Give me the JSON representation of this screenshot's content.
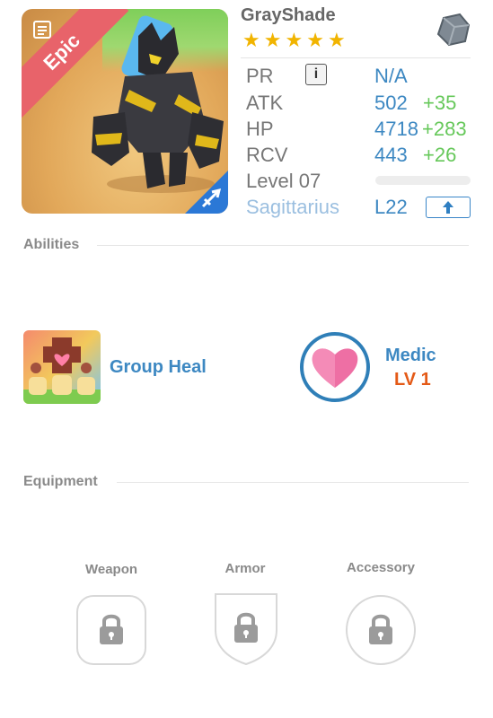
{
  "hero": {
    "name": "GrayShade",
    "rarity": "Epic",
    "stars": 5,
    "star_glyph": "★",
    "accent_star_color": "#f1b400"
  },
  "stats": {
    "pr_label": "PR",
    "pr_info": "i",
    "pr_value": "N/A",
    "atk_label": "ATK",
    "atk_value": "502",
    "atk_bonus": "+35",
    "hp_label": "HP",
    "hp_value": "4718",
    "hp_bonus": "+283",
    "rcv_label": "RCV",
    "rcv_value": "443",
    "rcv_bonus": "+26",
    "level_label": "Level 07",
    "level_progress": 0,
    "sign_label": "Sagittarius",
    "sign_level": "L22"
  },
  "abilities": {
    "section_title": "Abilities",
    "skill_name": "Group Heal",
    "trait_name": "Medic",
    "trait_level": "LV 1"
  },
  "equipment": {
    "section_title": "Equipment",
    "slots": [
      "Weapon",
      "Armor",
      "Accessory"
    ]
  },
  "icons": {
    "card": "card-icon",
    "rarity_corner": "bow-icon",
    "element": "rock-icon",
    "upgrade": "arrow-up-icon",
    "lock": "lock-icon",
    "heart": "heart-icon"
  }
}
